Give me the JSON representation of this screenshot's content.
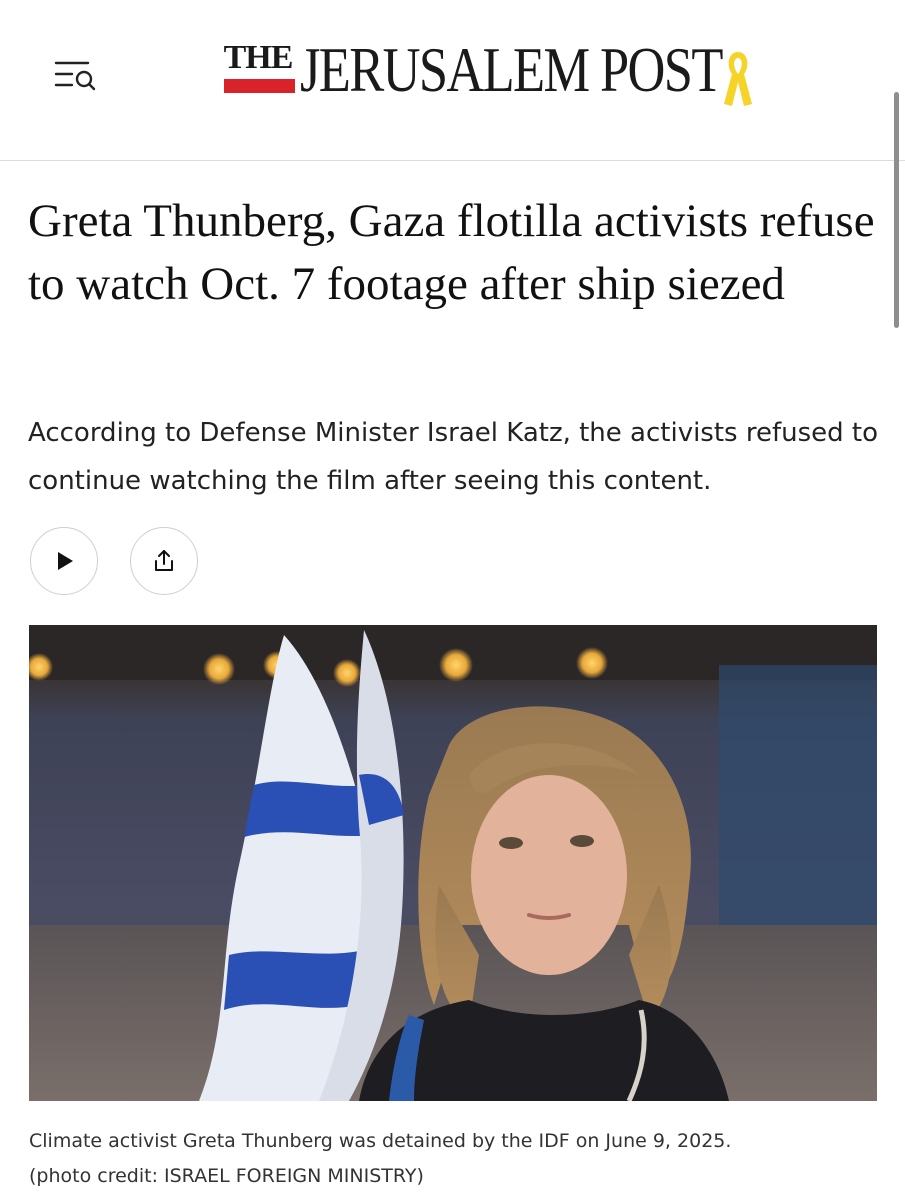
{
  "header": {
    "logo_the": "THE",
    "logo_main": "JERUSALEM POST",
    "menu_icon": "menu-search-icon",
    "ribbon_icon": "yellow-ribbon-icon",
    "ribbon_color": "#f5d327",
    "bar_color": "#d8232a"
  },
  "article": {
    "headline": "Greta Thunberg, Gaza flotilla activists refuse to watch Oct. 7 footage after ship siezed",
    "subheadline": "According to Defense Minister Israel Katz, the activists refused to continue watching the film after seeing this content.",
    "actions": {
      "play_icon": "play-icon",
      "share_icon": "share-icon"
    },
    "image": {
      "caption": "Climate activist Greta Thunberg was detained by the IDF on June 9, 2025.",
      "credit": "(photo credit: ISRAEL FOREIGN MINISTRY)"
    }
  }
}
